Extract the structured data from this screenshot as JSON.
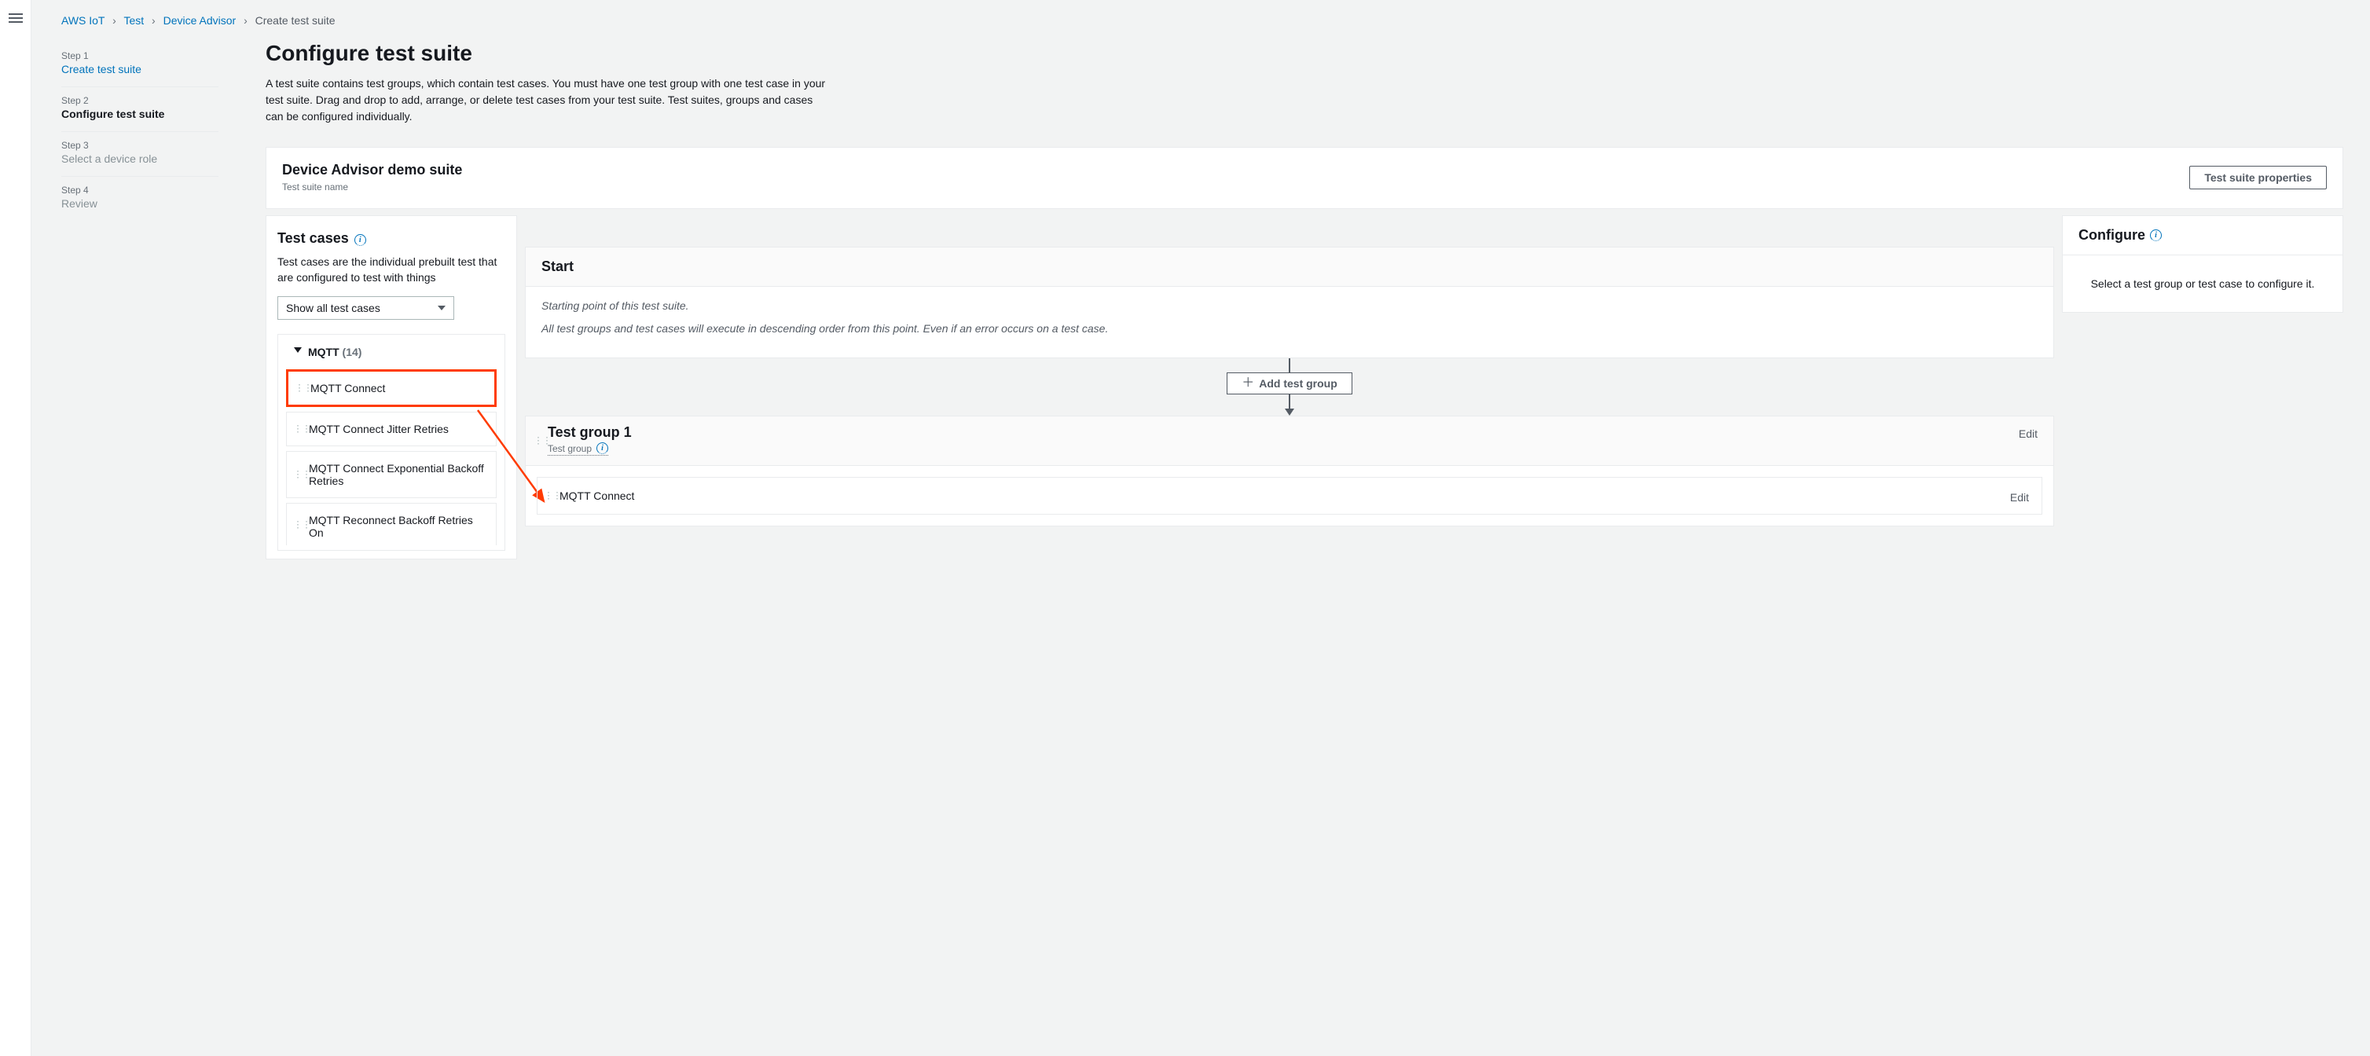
{
  "breadcrumb": {
    "items": [
      "AWS IoT",
      "Test",
      "Device Advisor"
    ],
    "current": "Create test suite"
  },
  "wizard": {
    "steps": [
      {
        "label": "Step 1",
        "title": "Create test suite",
        "state": "link"
      },
      {
        "label": "Step 2",
        "title": "Configure test suite",
        "state": "active"
      },
      {
        "label": "Step 3",
        "title": "Select a device role",
        "state": "disabled"
      },
      {
        "label": "Step 4",
        "title": "Review",
        "state": "disabled"
      }
    ]
  },
  "page": {
    "title": "Configure test suite",
    "description": "A test suite contains test groups, which contain test cases. You must have one test group with one test case in your test suite. Drag and drop to add, arrange, or delete test cases from your test suite. Test suites, groups and cases can be configured individually."
  },
  "suiteHeader": {
    "name": "Device Advisor demo suite",
    "sub": "Test suite name",
    "propertiesBtn": "Test suite properties"
  },
  "testCases": {
    "heading": "Test cases",
    "desc": "Test cases are the individual prebuilt test that are configured to test with things",
    "filterLabel": "Show all test cases",
    "group": {
      "name": "MQTT",
      "count": "(14)",
      "items": [
        "MQTT Connect",
        "MQTT Connect Jitter Retries",
        "MQTT Connect Exponential Backoff Retries",
        "MQTT Reconnect Backoff Retries On"
      ]
    }
  },
  "start": {
    "heading": "Start",
    "line1": "Starting point of this test suite.",
    "line2": "All test groups and test cases will execute in descending order from this point. Even if an error occurs on a test case."
  },
  "addGroupBtn": "Add test group",
  "testGroup": {
    "title": "Test group 1",
    "sub": "Test group",
    "editLabel": "Edit",
    "case": "MQTT Connect"
  },
  "configure": {
    "heading": "Configure",
    "placeholder": "Select a test group or test case to configure it."
  }
}
